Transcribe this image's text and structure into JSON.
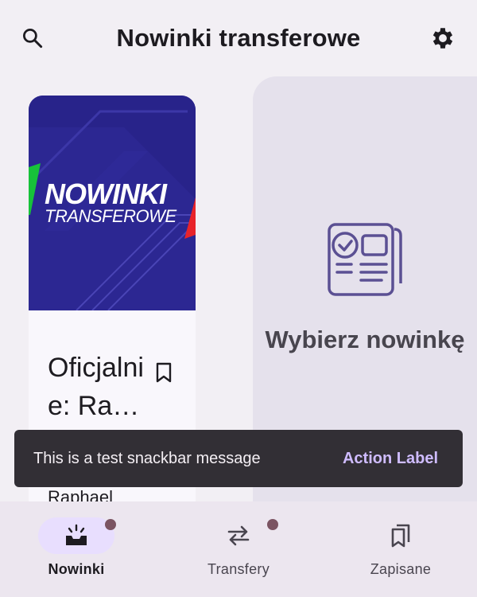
{
  "header": {
    "title": "Nowinki transferowe",
    "search_icon": "search-icon",
    "settings_icon": "gear-icon"
  },
  "card": {
    "hero_line1": "NOWINKI",
    "hero_line2": "TRANSFEROWE",
    "headline": "Oficjalnie: Ra…",
    "author": "Raphael",
    "bookmark_icon": "bookmark-outline-icon"
  },
  "detail": {
    "placeholder_icon": "newspaper-check-icon",
    "placeholder_text": "Wybierz nowinkę"
  },
  "snackbar": {
    "message": "This is a test snackbar message",
    "action": "Action Label"
  },
  "bottom_nav": {
    "items": [
      {
        "label": "Nowinki",
        "icon": "news-inbox-icon",
        "active": true,
        "badge": true
      },
      {
        "label": "Transfery",
        "icon": "swap-arrows-icon",
        "active": false,
        "badge": true
      },
      {
        "label": "Zapisane",
        "icon": "bookmarks-icon",
        "active": false,
        "badge": false
      }
    ]
  },
  "colors": {
    "background": "#f2eff4",
    "detail_surface": "#e5e1ec",
    "accent": "#cfbcff",
    "active_pill": "#e8defe",
    "badge": "#7b5462",
    "hero": "#28238a"
  }
}
